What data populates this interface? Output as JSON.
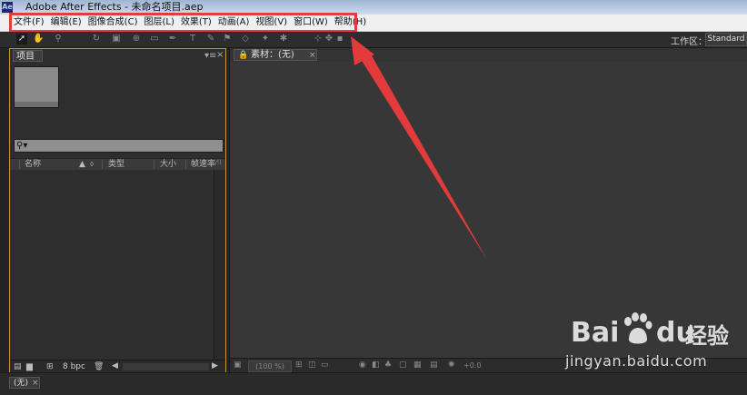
{
  "window": {
    "title": "Adobe After Effects - 未命名项目.aep",
    "app_icon_text": "Ae"
  },
  "menu": {
    "items": [
      "文件(F)",
      "编辑(E)",
      "图像合成(C)",
      "图层(L)",
      "效果(T)",
      "动画(A)",
      "视图(V)",
      "窗口(W)",
      "帮助(H)"
    ]
  },
  "toolbar": {
    "workspace_label": "工作区：",
    "workspace_value": "Standard"
  },
  "project_panel": {
    "tab_label": "项目",
    "columns": [
      "名称",
      "类型",
      "大小",
      "帧速率"
    ],
    "footer": {
      "bpc": "8 bpc"
    }
  },
  "footage_panel": {
    "tab_label": "素材：(无)",
    "zoom": "(100 %)",
    "offset": "+0.0"
  },
  "timeline": {
    "tab_label": "(无)"
  },
  "watermark": {
    "brand_left": "Bai",
    "brand_right": "du",
    "brand_cn": "经验",
    "url": "jingyan.baidu.com"
  },
  "colors": {
    "highlight": "#e23c3c",
    "panel_border_active": "#c79a2b"
  },
  "icons": [
    "select-tool-icon",
    "hand-tool-icon",
    "zoom-tool-icon",
    "lock-icon",
    "search-icon",
    "tag-icon",
    "flow-icon",
    "folder-icon",
    "trash-icon",
    "close-icon"
  ]
}
